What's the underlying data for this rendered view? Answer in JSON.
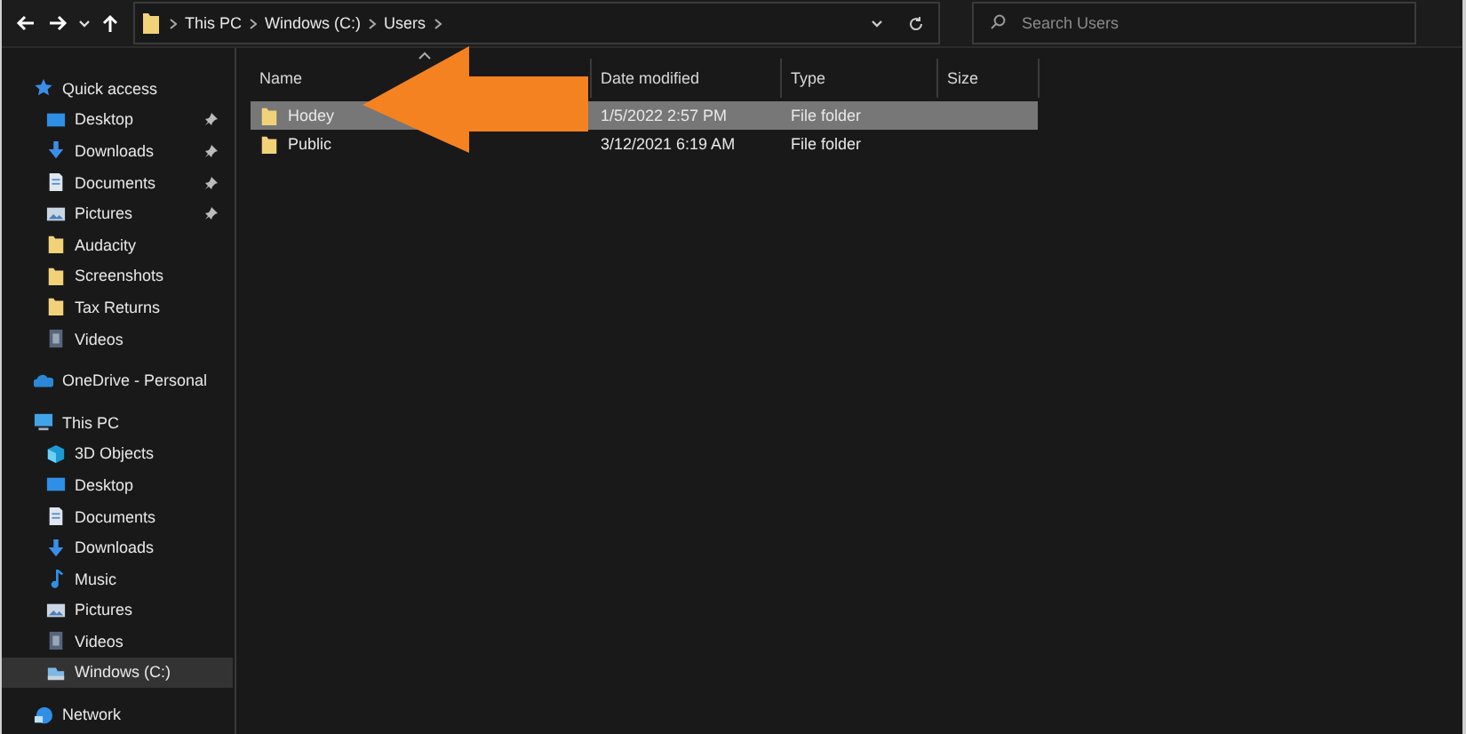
{
  "address_bar": {
    "crumbs": [
      "This PC",
      "Windows (C:)",
      "Users"
    ]
  },
  "search": {
    "placeholder": "Search Users"
  },
  "sidebar": {
    "items": [
      {
        "label": "Quick access",
        "kind": "star",
        "selected": false,
        "children": [
          {
            "label": "Desktop",
            "kind": "desktop",
            "pinned": true,
            "selected": false
          },
          {
            "label": "Downloads",
            "kind": "downloads",
            "pinned": true,
            "selected": false
          },
          {
            "label": "Documents",
            "kind": "documents",
            "pinned": true,
            "selected": false
          },
          {
            "label": "Pictures",
            "kind": "pictures",
            "pinned": true,
            "selected": false
          },
          {
            "label": "Audacity",
            "kind": "folder",
            "pinned": false,
            "selected": false
          },
          {
            "label": "Screenshots",
            "kind": "folder",
            "pinned": false,
            "selected": false
          },
          {
            "label": "Tax Returns",
            "kind": "folder",
            "pinned": false,
            "selected": false
          },
          {
            "label": "Videos",
            "kind": "videos",
            "pinned": false,
            "selected": false
          }
        ]
      },
      {
        "label": "OneDrive - Personal",
        "kind": "cloud",
        "selected": false
      },
      {
        "label": "This PC",
        "kind": "pc",
        "selected": false,
        "children": [
          {
            "label": "3D Objects",
            "kind": "cube",
            "selected": false
          },
          {
            "label": "Desktop",
            "kind": "desktop",
            "selected": false
          },
          {
            "label": "Documents",
            "kind": "documents",
            "selected": false
          },
          {
            "label": "Downloads",
            "kind": "downloads",
            "selected": false
          },
          {
            "label": "Music",
            "kind": "music",
            "selected": false
          },
          {
            "label": "Pictures",
            "kind": "pictures",
            "selected": false
          },
          {
            "label": "Videos",
            "kind": "videos",
            "selected": false
          },
          {
            "label": "Windows (C:)",
            "kind": "drive",
            "selected": true
          }
        ]
      },
      {
        "label": "Network",
        "kind": "network",
        "selected": false
      }
    ]
  },
  "table": {
    "columns": [
      "Name",
      "Date modified",
      "Type",
      "Size"
    ],
    "rows": [
      {
        "name": "Hodey",
        "date": "1/5/2022 2:57 PM",
        "type": "File folder",
        "selected": true
      },
      {
        "name": "Public",
        "date": "3/12/2021 6:19 AM",
        "type": "File folder",
        "selected": false
      }
    ]
  }
}
